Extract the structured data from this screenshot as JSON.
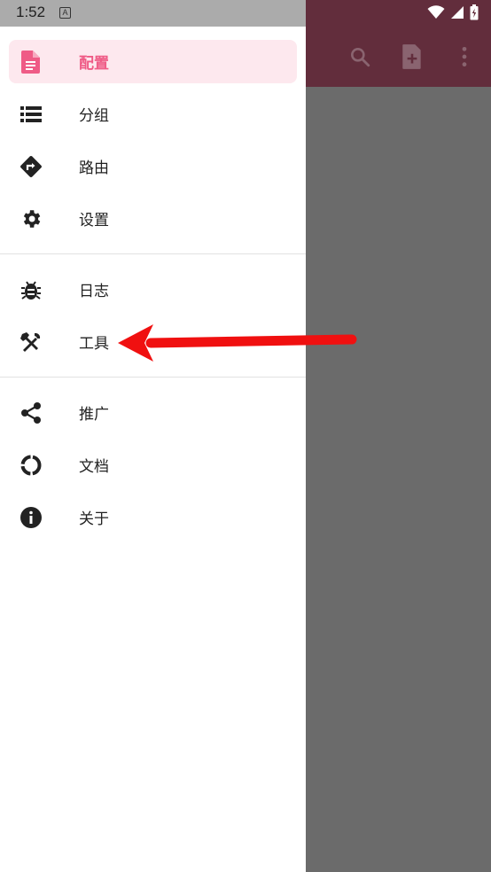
{
  "status_bar": {
    "time": "1:52",
    "notification_icon_letter": "A",
    "icons": [
      "wifi-icon",
      "signal-icon",
      "battery-charging-icon"
    ]
  },
  "background_app": {
    "toolbar_color": "#622d3c",
    "toolbar_icons": [
      "search-icon",
      "add-file-icon",
      "more-vert-icon"
    ]
  },
  "drawer": {
    "accent_color": "#ef5b86",
    "groups": [
      {
        "items": [
          {
            "label": "配置",
            "icon": "document-icon",
            "selected": true
          },
          {
            "label": "分组",
            "icon": "list-icon",
            "selected": false
          },
          {
            "label": "路由",
            "icon": "directions-icon",
            "selected": false
          },
          {
            "label": "设置",
            "icon": "gear-icon",
            "selected": false
          }
        ]
      },
      {
        "items": [
          {
            "label": "日志",
            "icon": "bug-icon",
            "selected": false
          },
          {
            "label": "工具",
            "icon": "tools-icon",
            "selected": false
          }
        ]
      },
      {
        "items": [
          {
            "label": "推广",
            "icon": "share-icon",
            "selected": false
          },
          {
            "label": "文档",
            "icon": "donut-icon",
            "selected": false
          },
          {
            "label": "关于",
            "icon": "info-icon",
            "selected": false
          }
        ]
      }
    ]
  },
  "annotation": {
    "type": "red-arrow",
    "points_to": "工具",
    "color": "#f01010"
  }
}
